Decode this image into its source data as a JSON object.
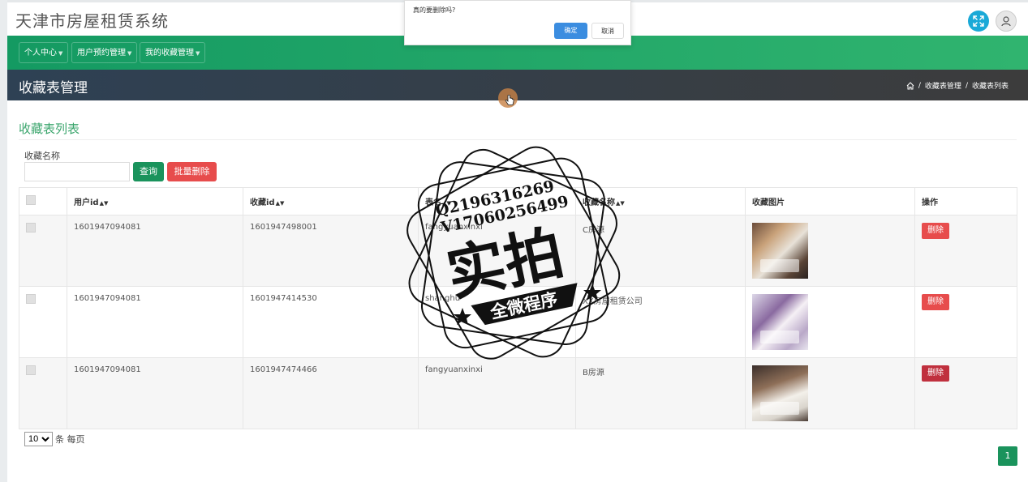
{
  "app": {
    "title": "天津市房屋租赁系统"
  },
  "nav": [
    {
      "label": "个人中心"
    },
    {
      "label": "用户预约管理"
    },
    {
      "label": "我的收藏管理"
    }
  ],
  "page": {
    "title": "收藏表管理",
    "breadcrumb": [
      "收藏表管理",
      "收藏表列表"
    ]
  },
  "section": {
    "title": "收藏表列表"
  },
  "filter": {
    "label": "收藏名称",
    "value": "",
    "search_label": "查询",
    "batch_delete_label": "批量删除"
  },
  "table": {
    "columns": [
      "用户id",
      "收藏id",
      "表名",
      "收藏名称",
      "收藏图片",
      "操作"
    ],
    "rows": [
      {
        "userid": "1601947094081",
        "refid": "1601947498001",
        "tablename": "fangyuanxinxi",
        "name": "C房源",
        "action": "删除"
      },
      {
        "userid": "1601947094081",
        "refid": "1601947414530",
        "tablename": "shanghu",
        "name": "XX房屋租赁公司",
        "action": "删除"
      },
      {
        "userid": "1601947094081",
        "refid": "1601947474466",
        "tablename": "fangyuanxinxi",
        "name": "B房源",
        "action": "删除"
      }
    ]
  },
  "pagination": {
    "page_size": "10",
    "page_size_suffix": "条 每页",
    "current_page": "1"
  },
  "dialog": {
    "message": "真的要删除吗?",
    "confirm": "确定",
    "cancel": "取消"
  },
  "watermark": {
    "lines": [
      "Q2196316269",
      "V17060256499",
      "实拍",
      "全微程序"
    ]
  },
  "colors": {
    "nav": "#1c9f66",
    "accent": "#3aa56c",
    "danger": "#e74c4c",
    "primary": "#3b8de0"
  }
}
